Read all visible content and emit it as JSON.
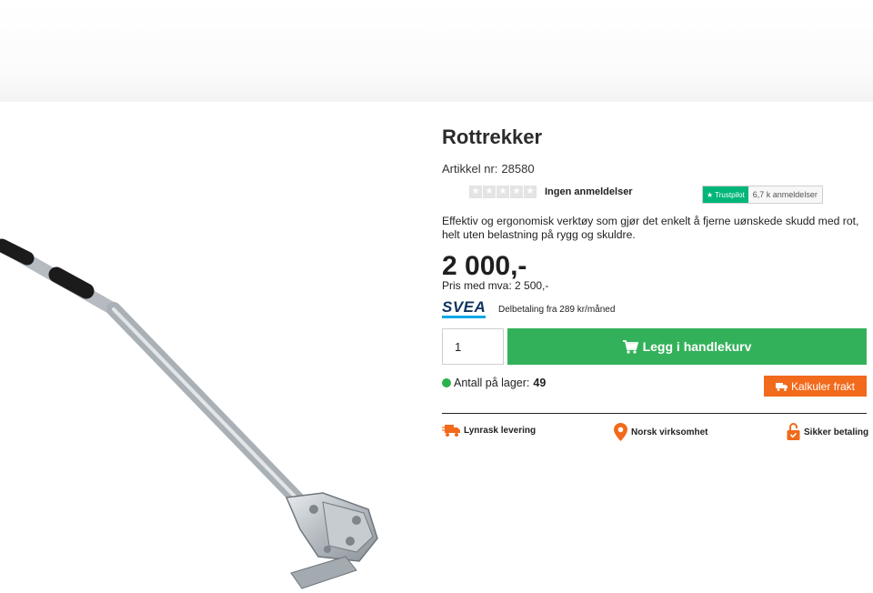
{
  "product": {
    "title": "Rottrekker",
    "sku_label": "Artikkel nr:",
    "sku": "28580",
    "reviews_text": "Ingen anmeldelser",
    "trustpilot_label": "Trustpilot",
    "trustpilot_count": "6,7 k anmeldelser",
    "description": "Effektiv og ergonomisk verktøy som gjør det enkelt å fjerne uønskede skudd med rot, helt uten belastning på rygg og skuldre.",
    "price": "2 000,-",
    "price_vat": "Pris med mva: 2 500,-",
    "svea_logo": "SVEA",
    "installment": "Delbetaling fra 289 kr/måned"
  },
  "cart": {
    "quantity": "1",
    "add_label": "Legg i handlekurv"
  },
  "stock": {
    "label": "Antall på lager:",
    "value": "49"
  },
  "freight": {
    "label": "Kalkuler frakt"
  },
  "usps": [
    {
      "label": "Lynrask levering",
      "icon": "truck-icon"
    },
    {
      "label": "Norsk virksomhet",
      "icon": "location-pin-icon"
    },
    {
      "label": "Sikker betaling",
      "icon": "lock-icon"
    }
  ],
  "colors": {
    "primary_green": "#33b15a",
    "accent_orange": "#f26a1b",
    "stock_green": "#2bb24c",
    "trustpilot_green": "#00b67a",
    "svea_navy": "#10345e"
  }
}
